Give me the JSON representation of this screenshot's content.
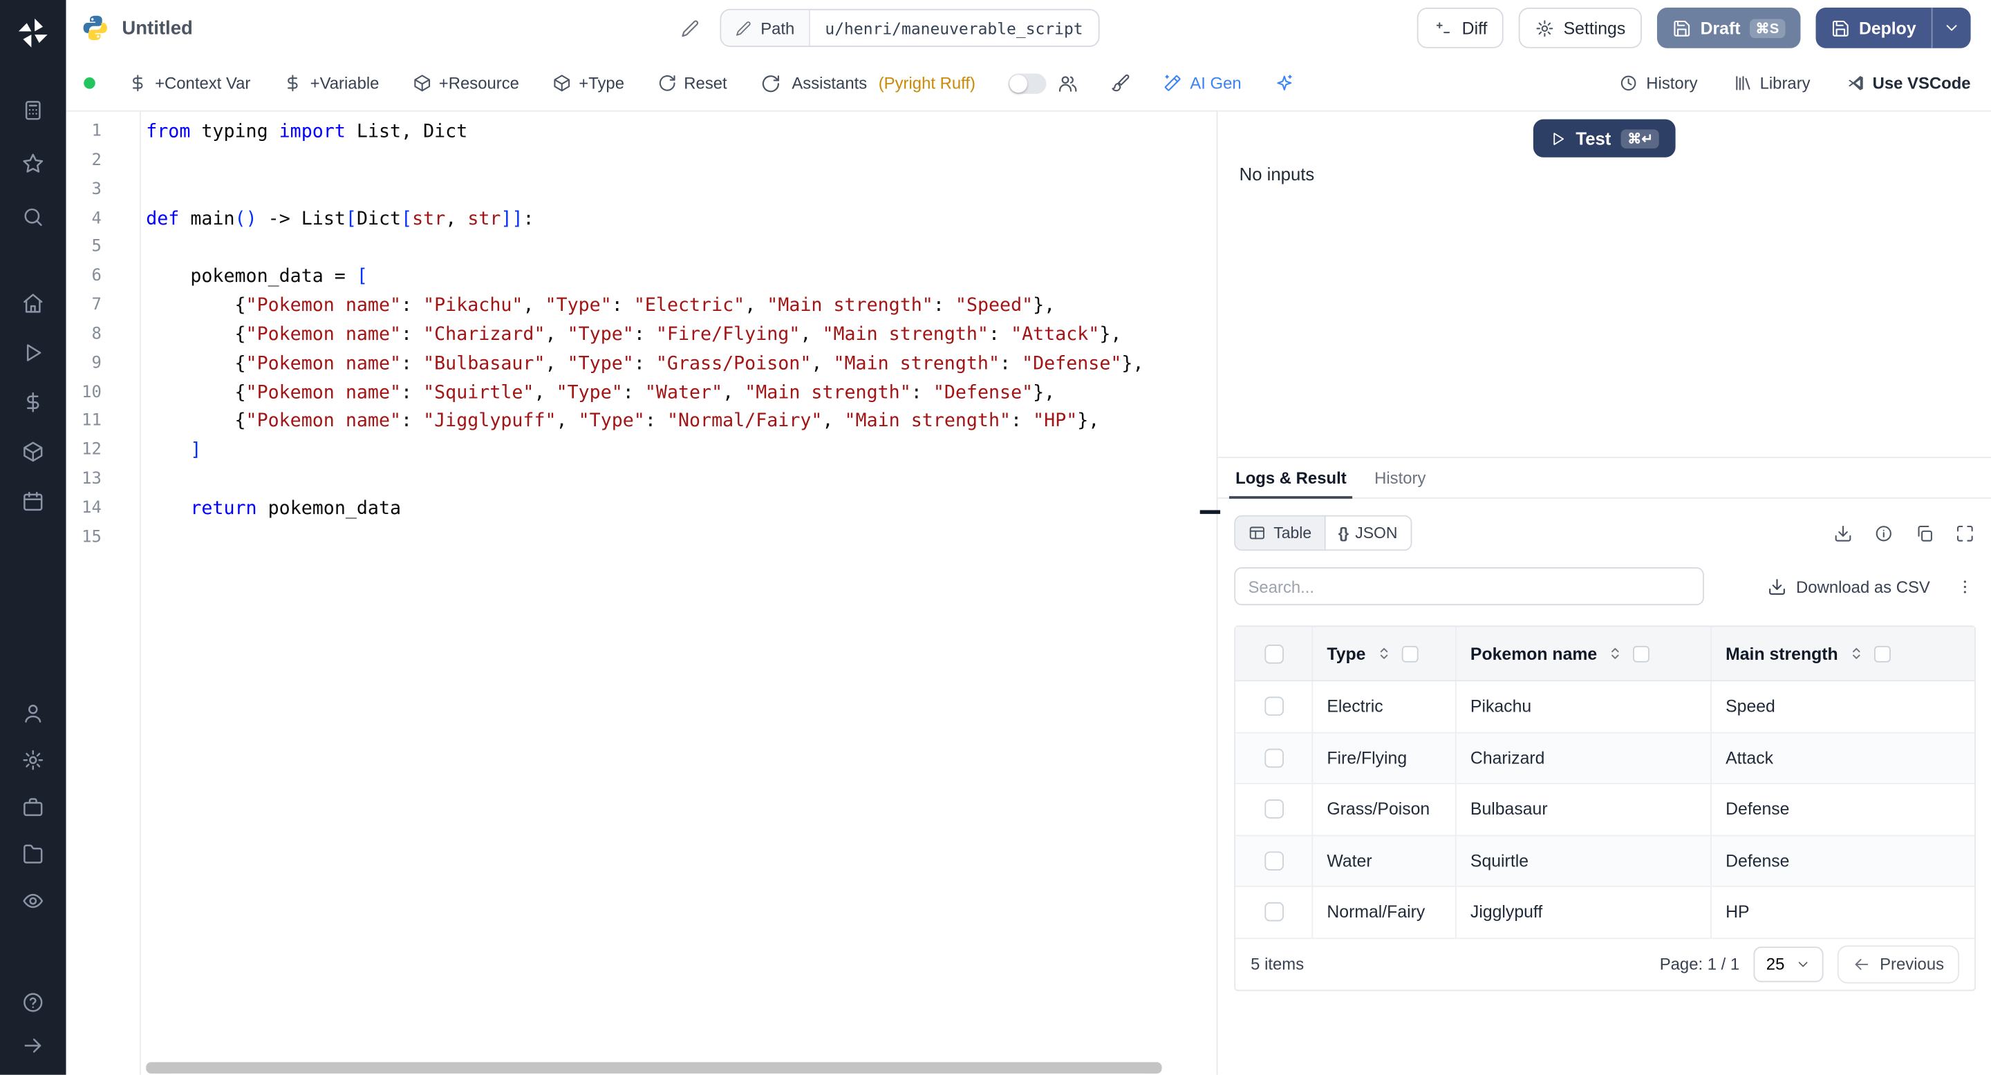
{
  "colors": {
    "accent_blue": "#3b82f6",
    "success_green": "#22c55e",
    "assistant_amber": "#ca8a04",
    "draft_button": "#6e80a0",
    "deploy_button": "#45588c",
    "test_button": "#2e3f66",
    "sidebar_bg": "#1a202c",
    "keyword_blue": "#0000ff",
    "string_red": "#a31515",
    "bracket_blue": "#0431fa"
  },
  "sidebar": {
    "groups": [
      [
        "apps",
        "favorites",
        "search"
      ],
      [
        "home",
        "runs",
        "variables",
        "resources",
        "schedules"
      ],
      [
        "users",
        "settings",
        "workers",
        "folders",
        "audit-logs"
      ],
      [
        "help",
        "expand"
      ]
    ]
  },
  "header": {
    "title": "Untitled",
    "path_label": "Path",
    "path_value": "u/henri/maneuverable_script",
    "diff": "Diff",
    "settings": "Settings",
    "draft": "Draft",
    "draft_shortcut": "⌘S",
    "deploy": "Deploy"
  },
  "toolbar": {
    "context_var": "+Context Var",
    "variable": "+Variable",
    "resource": "+Resource",
    "type": "+Type",
    "reset": "Reset",
    "assistants": "Assistants",
    "assistants_detail": "(Pyright Ruff)",
    "ai_gen": "AI Gen",
    "history": "History",
    "library": "Library",
    "use_vscode": "Use VSCode"
  },
  "editor": {
    "lines": [
      {
        "n": 1,
        "t": [
          [
            "kw",
            "from"
          ],
          [
            "pl",
            " typing "
          ],
          [
            "kw",
            "import"
          ],
          [
            "pl",
            " List, Dict"
          ]
        ]
      },
      {
        "n": 2,
        "t": []
      },
      {
        "n": 3,
        "t": []
      },
      {
        "n": 4,
        "t": [
          [
            "kw",
            "def"
          ],
          [
            "pl",
            " main"
          ],
          [
            "br",
            "()"
          ],
          [
            "pl",
            " -> List"
          ],
          [
            "br",
            "["
          ],
          [
            "pl",
            "Dict"
          ],
          [
            "br",
            "["
          ],
          [
            "ty",
            "str"
          ],
          [
            "pl",
            ", "
          ],
          [
            "ty",
            "str"
          ],
          [
            "br",
            "]]"
          ],
          [
            "pl",
            ":"
          ]
        ]
      },
      {
        "n": 5,
        "t": []
      },
      {
        "n": 6,
        "t": [
          [
            "pl",
            "    pokemon_data = "
          ],
          [
            "br",
            "["
          ]
        ]
      },
      {
        "n": 7,
        "t": [
          [
            "pl",
            "        {"
          ],
          [
            "str",
            "\"Pokemon name\""
          ],
          [
            "pl",
            ": "
          ],
          [
            "str",
            "\"Pikachu\""
          ],
          [
            "pl",
            ", "
          ],
          [
            "str",
            "\"Type\""
          ],
          [
            "pl",
            ": "
          ],
          [
            "str",
            "\"Electric\""
          ],
          [
            "pl",
            ", "
          ],
          [
            "str",
            "\"Main strength\""
          ],
          [
            "pl",
            ": "
          ],
          [
            "str",
            "\"Speed\""
          ],
          [
            "pl",
            "},"
          ]
        ]
      },
      {
        "n": 8,
        "t": [
          [
            "pl",
            "        {"
          ],
          [
            "str",
            "\"Pokemon name\""
          ],
          [
            "pl",
            ": "
          ],
          [
            "str",
            "\"Charizard\""
          ],
          [
            "pl",
            ", "
          ],
          [
            "str",
            "\"Type\""
          ],
          [
            "pl",
            ": "
          ],
          [
            "str",
            "\"Fire/Flying\""
          ],
          [
            "pl",
            ", "
          ],
          [
            "str",
            "\"Main strength\""
          ],
          [
            "pl",
            ": "
          ],
          [
            "str",
            "\"Attack\""
          ],
          [
            "pl",
            "},"
          ]
        ]
      },
      {
        "n": 9,
        "t": [
          [
            "pl",
            "        {"
          ],
          [
            "str",
            "\"Pokemon name\""
          ],
          [
            "pl",
            ": "
          ],
          [
            "str",
            "\"Bulbasaur\""
          ],
          [
            "pl",
            ", "
          ],
          [
            "str",
            "\"Type\""
          ],
          [
            "pl",
            ": "
          ],
          [
            "str",
            "\"Grass/Poison\""
          ],
          [
            "pl",
            ", "
          ],
          [
            "str",
            "\"Main strength\""
          ],
          [
            "pl",
            ": "
          ],
          [
            "str",
            "\"Defense\""
          ],
          [
            "pl",
            "},"
          ]
        ]
      },
      {
        "n": 10,
        "t": [
          [
            "pl",
            "        {"
          ],
          [
            "str",
            "\"Pokemon name\""
          ],
          [
            "pl",
            ": "
          ],
          [
            "str",
            "\"Squirtle\""
          ],
          [
            "pl",
            ", "
          ],
          [
            "str",
            "\"Type\""
          ],
          [
            "pl",
            ": "
          ],
          [
            "str",
            "\"Water\""
          ],
          [
            "pl",
            ", "
          ],
          [
            "str",
            "\"Main strength\""
          ],
          [
            "pl",
            ": "
          ],
          [
            "str",
            "\"Defense\""
          ],
          [
            "pl",
            "},"
          ]
        ]
      },
      {
        "n": 11,
        "t": [
          [
            "pl",
            "        {"
          ],
          [
            "str",
            "\"Pokemon name\""
          ],
          [
            "pl",
            ": "
          ],
          [
            "str",
            "\"Jigglypuff\""
          ],
          [
            "pl",
            ", "
          ],
          [
            "str",
            "\"Type\""
          ],
          [
            "pl",
            ": "
          ],
          [
            "str",
            "\"Normal/Fairy\""
          ],
          [
            "pl",
            ", "
          ],
          [
            "str",
            "\"Main strength\""
          ],
          [
            "pl",
            ": "
          ],
          [
            "str",
            "\"HP\""
          ],
          [
            "pl",
            "},"
          ]
        ]
      },
      {
        "n": 12,
        "t": [
          [
            "pl",
            "    "
          ],
          [
            "br",
            "]"
          ]
        ]
      },
      {
        "n": 13,
        "t": []
      },
      {
        "n": 14,
        "t": [
          [
            "pl",
            "    "
          ],
          [
            "kw",
            "return"
          ],
          [
            "pl",
            " pokemon_data"
          ]
        ]
      },
      {
        "n": 15,
        "t": []
      }
    ]
  },
  "run": {
    "test": "Test",
    "test_shortcut": "⌘↵",
    "no_inputs": "No inputs",
    "tab_logs": "Logs & Result",
    "tab_history": "History",
    "view_table": "Table",
    "view_json": "JSON",
    "json_icon": "{}",
    "search_placeholder": "Search...",
    "download_csv": "Download as CSV"
  },
  "table": {
    "columns": [
      "Type",
      "Pokemon name",
      "Main strength"
    ],
    "rows": [
      [
        "Electric",
        "Pikachu",
        "Speed"
      ],
      [
        "Fire/Flying",
        "Charizard",
        "Attack"
      ],
      [
        "Grass/Poison",
        "Bulbasaur",
        "Defense"
      ],
      [
        "Water",
        "Squirtle",
        "Defense"
      ],
      [
        "Normal/Fairy",
        "Jigglypuff",
        "HP"
      ]
    ],
    "items_text": "5 items",
    "page_text": "Page: 1 / 1",
    "page_size": "25",
    "previous": "Previous"
  }
}
